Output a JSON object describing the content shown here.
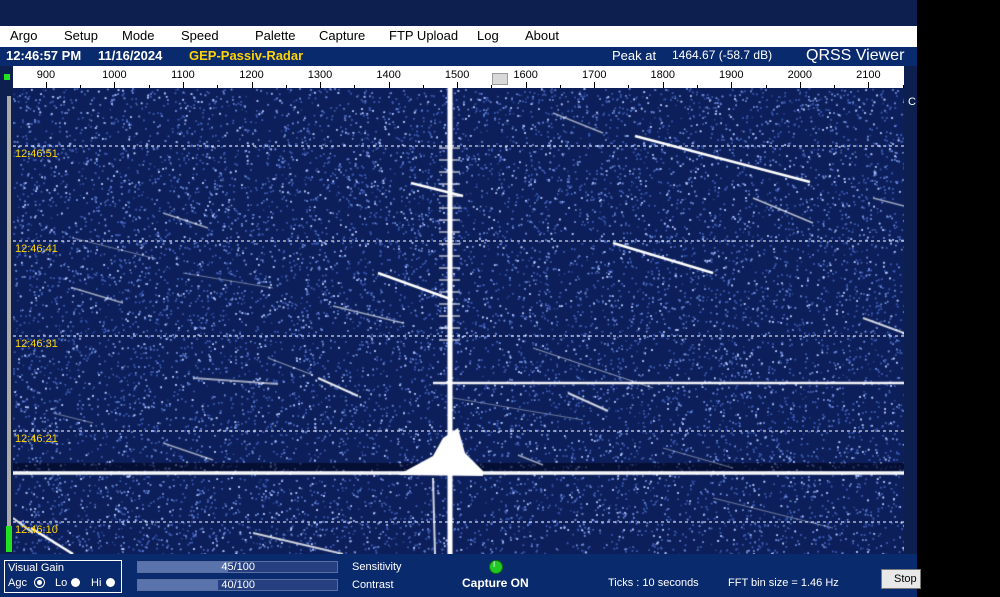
{
  "menu": [
    "Argo",
    "Setup",
    "Mode",
    "Speed",
    "Palette",
    "Capture",
    "FTP Upload",
    "Log",
    "About"
  ],
  "info": {
    "time": "12:46:57 PM",
    "date": "11/16/2024",
    "station": "GEP-Passiv-Radar",
    "peak_label": "Peak at",
    "peak_value": "1464.67 (-58.7 dB)",
    "brand": "QRSS Viewer"
  },
  "freq_scale": {
    "labels": [
      "900",
      "1000",
      "1100",
      "1200",
      "1300",
      "1400",
      "1500",
      "1600",
      "1700",
      "1800",
      "1900",
      "2000",
      "2100"
    ],
    "min_hz": 852,
    "max_hz": 2152
  },
  "right_strip_text": "C",
  "time_markers": [
    "12:46:51",
    "12:46:41",
    "12:46:31",
    "12:46:21",
    "12:46:10"
  ],
  "controls": {
    "visual_gain": {
      "title": "Visual Gain",
      "options": [
        "Agc",
        "Lo",
        "Hi"
      ],
      "selected": "Agc"
    },
    "sensitivity": {
      "label": "Sensitivity",
      "value": "45/100",
      "fraction": 0.45
    },
    "contrast": {
      "label": "Contrast",
      "value": "40/100",
      "fraction": 0.4
    },
    "capture_led": "I",
    "capture_status": "Capture ON",
    "ticks": "Ticks  : 10 seconds",
    "fft_bin": "FFT bin size = 1.46 Hz",
    "stop_label": "Stop"
  },
  "colors": {
    "spectrogram_bg": "#0c1f5a",
    "trace": "#ffffff",
    "time_label": "#ffd400",
    "station": "#ffd400",
    "capture_led": "#22c822"
  }
}
